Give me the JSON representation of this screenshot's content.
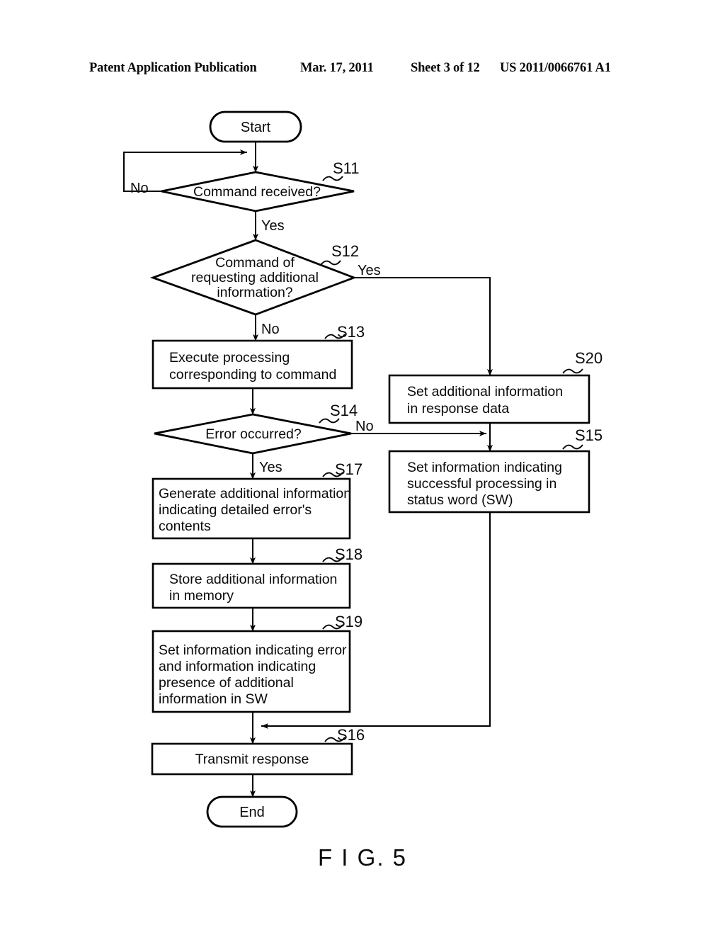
{
  "header": {
    "title": "Patent Application Publication",
    "date": "Mar. 17, 2011",
    "sheet": "Sheet 3 of 12",
    "publication_number": "US 2011/0066761 A1"
  },
  "figure": {
    "caption": "F I G. 5"
  },
  "flowchart": {
    "start_label": "Start",
    "end_label": "End",
    "nodes": [
      {
        "id": "S11",
        "step": "S11",
        "type": "decision",
        "text": "Command received?"
      },
      {
        "id": "S12",
        "step": "S12",
        "type": "decision",
        "text_line1": "Command of",
        "text_line2": "requesting additional",
        "text_line3": "information?"
      },
      {
        "id": "S13",
        "step": "S13",
        "type": "process",
        "text_line1": "Execute processing",
        "text_line2": "corresponding to command"
      },
      {
        "id": "S14",
        "step": "S14",
        "type": "decision",
        "text": "Error occurred?"
      },
      {
        "id": "S20",
        "step": "S20",
        "type": "process",
        "text_line1": "Set additional information",
        "text_line2": "in response data"
      },
      {
        "id": "S15",
        "step": "S15",
        "type": "process",
        "text_line1": "Set information indicating",
        "text_line2": "successful processing in",
        "text_line3": "status word (SW)"
      },
      {
        "id": "S17",
        "step": "S17",
        "type": "process",
        "text_line1": "Generate additional information",
        "text_line2": "indicating detailed error's",
        "text_line3": "contents"
      },
      {
        "id": "S18",
        "step": "S18",
        "type": "process",
        "text_line1": "Store additional information",
        "text_line2": "in memory"
      },
      {
        "id": "S19",
        "step": "S19",
        "type": "process",
        "text_line1": "Set information indicating error",
        "text_line2": "and information indicating",
        "text_line3": "presence of additional",
        "text_line4": "information in SW"
      },
      {
        "id": "S16",
        "step": "S16",
        "type": "process",
        "text": "Transmit response"
      }
    ],
    "branch_labels": {
      "s11_no": "No",
      "s11_yes": "Yes",
      "s12_yes": "Yes",
      "s12_no": "No",
      "s14_no": "No",
      "s14_yes": "Yes"
    }
  }
}
